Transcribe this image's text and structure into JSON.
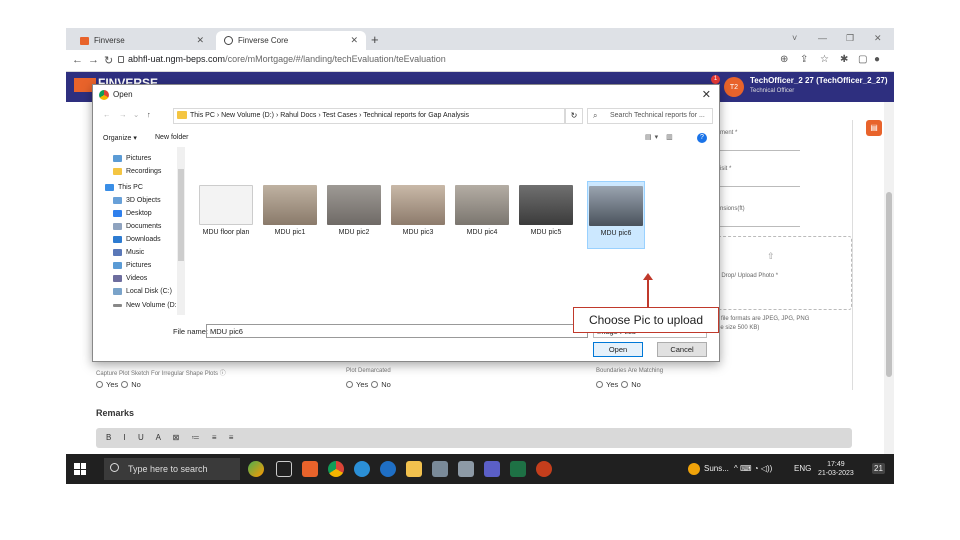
{
  "browser": {
    "tabs": [
      {
        "title": "Finverse"
      },
      {
        "title": "Finverse Core"
      }
    ],
    "url_domain": "abhfl-uat.ngm-beps.com",
    "url_path": "/core/mMortgage/#/landing/techEvaluation/teEvaluation",
    "window_controls": [
      "˅",
      "—",
      "❐",
      "✕"
    ]
  },
  "app": {
    "brand": "FINVERSE",
    "user_initials": "T2",
    "notification_count": "1",
    "user_name": "TechOfficer_2 27 (TechOfficer_2_27)",
    "user_role": "Technical Officer",
    "right_panel": {
      "label1": "ment *",
      "label2": "isit *",
      "label3": "nsions(ft)",
      "upload_text": "Drag & Drop/ Upload Photo *",
      "formats_line1": "d file formats are JPEG, JPG, PNG",
      "formats_line2": "file size 500 KB)"
    },
    "fields": [
      {
        "label": "Capture Plot Sketch For Irregular Shape Plots ⓘ",
        "yes": "Yes",
        "no": "No"
      },
      {
        "label": "Plot Demarcated",
        "yes": "Yes",
        "no": "No"
      },
      {
        "label": "Boundaries Are Matching",
        "yes": "Yes",
        "no": "No"
      }
    ],
    "remarks_title": "Remarks",
    "editor_tools": "B I U A ⊠ ≔ ≡ ≡"
  },
  "dialog": {
    "title": "Open",
    "breadcrumb": "This PC  ›  New Volume (D:)  ›  Rahul Docs  ›  Test Cases  ›  Technical reports for Gap Analysis",
    "search_placeholder": "Search Technical reports for ...",
    "organize": "Organize ▾",
    "new_folder": "New folder",
    "nav_items": [
      {
        "label": "Pictures",
        "color": "#5b9bd5"
      },
      {
        "label": "Recordings",
        "color": "#f4c542"
      },
      {
        "label": "This PC",
        "color": "#3a8ee6"
      },
      {
        "label": "3D Objects",
        "color": "#68a0d8"
      },
      {
        "label": "Desktop",
        "color": "#2f80ed"
      },
      {
        "label": "Documents",
        "color": "#8fa3bf"
      },
      {
        "label": "Downloads",
        "color": "#2d7bd1"
      },
      {
        "label": "Music",
        "color": "#5a78b8"
      },
      {
        "label": "Pictures",
        "color": "#5b9bd5"
      },
      {
        "label": "Videos",
        "color": "#6d6d9e"
      },
      {
        "label": "Local Disk (C:)",
        "color": "#7aa3c9"
      },
      {
        "label": "New Volume (D: ⌄",
        "color": "#888888"
      }
    ],
    "files": [
      {
        "name": "MDU floor plan",
        "color": "#f3f3f3"
      },
      {
        "name": "MDU pic1",
        "color": "#8a7a6a"
      },
      {
        "name": "MDU pic2",
        "color": "#6f6a66"
      },
      {
        "name": "MDU pic3",
        "color": "#8d7b6c"
      },
      {
        "name": "MDU pic4",
        "color": "#7b766f"
      },
      {
        "name": "MDU pic5",
        "color": "#4b4b4b"
      },
      {
        "name": "MDU pic6",
        "color": "#5c6470"
      }
    ],
    "filename_label": "File name:",
    "filename_value": "MDU pic6",
    "filetype_value": "Image Files",
    "open_button": "Open",
    "cancel_button": "Cancel"
  },
  "annotation": {
    "callout_text": "Choose Pic to upload"
  },
  "taskbar": {
    "search_placeholder": "Type here to search",
    "weather": "Suns...",
    "tray_icons": "^ ⌨ ◔ ◁))",
    "language": "ENG",
    "time": "17:49",
    "date": "21-03-2023",
    "notif_count": "21"
  }
}
